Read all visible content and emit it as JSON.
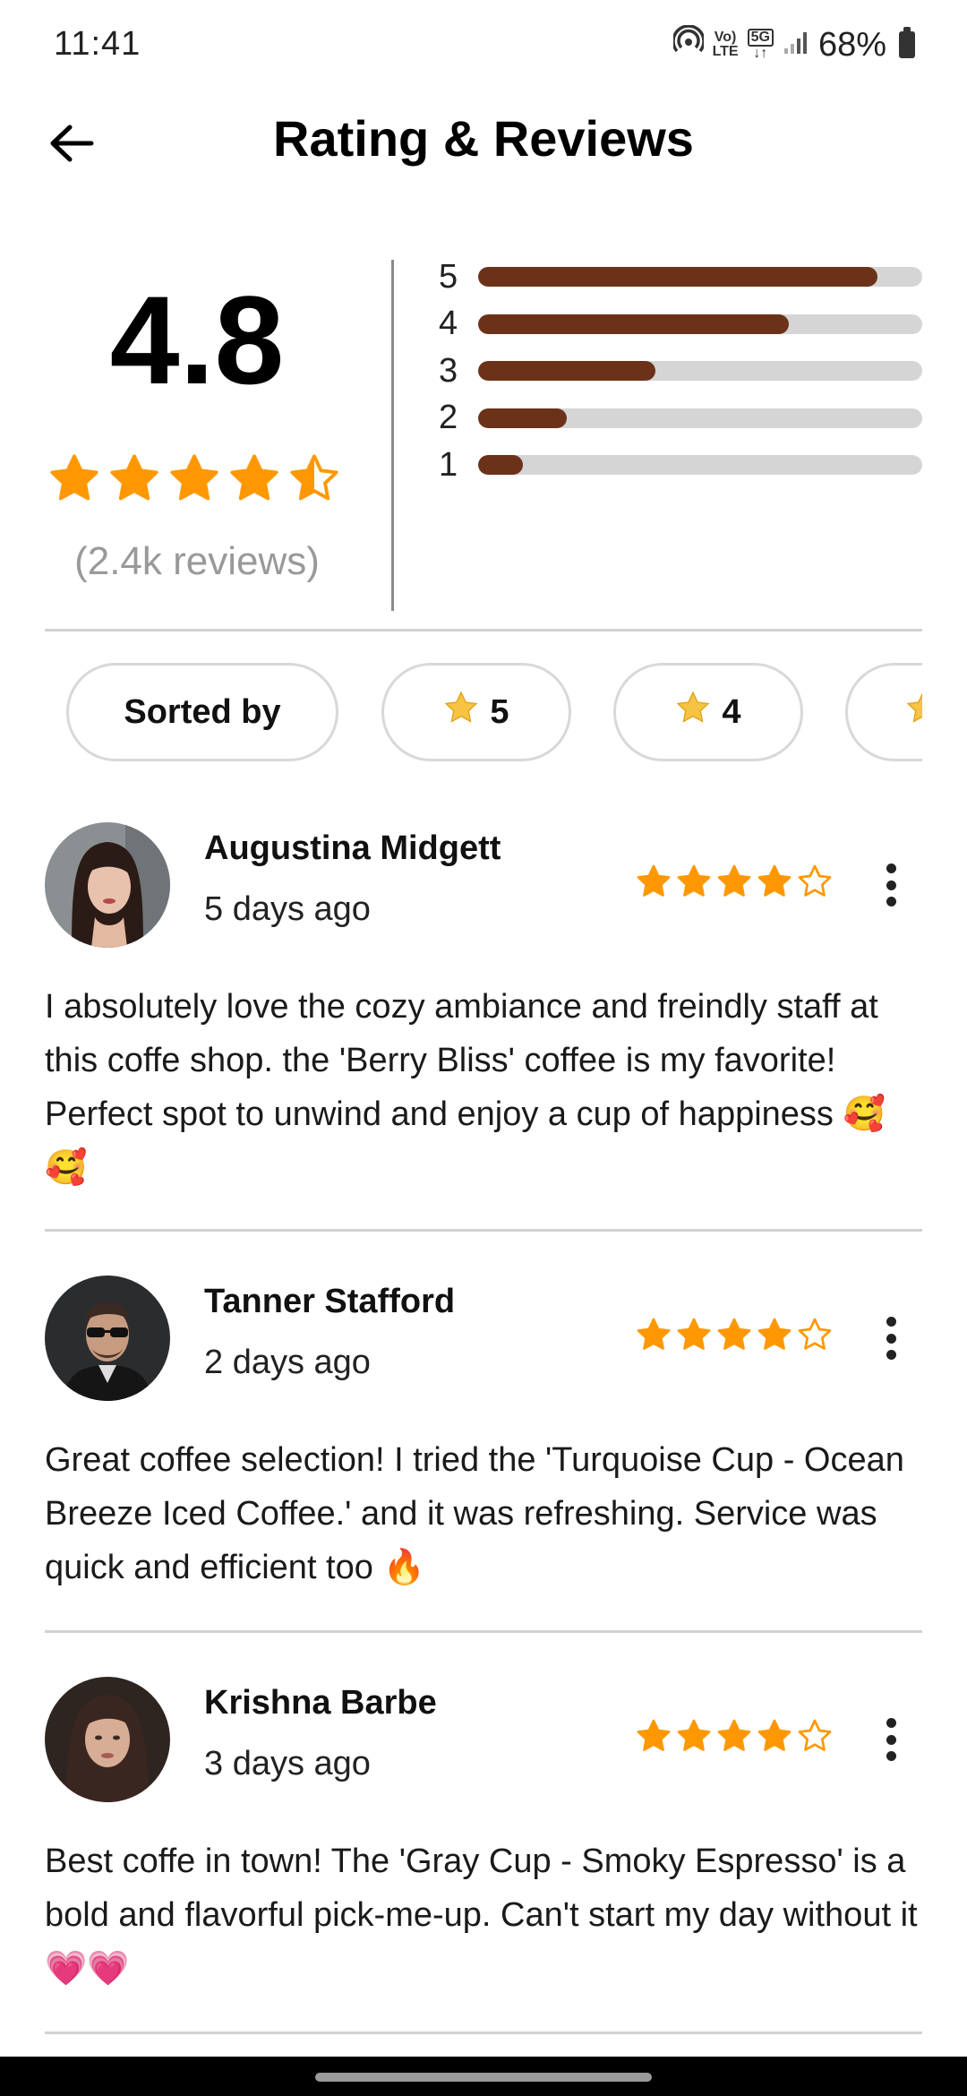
{
  "status_bar": {
    "time": "11:41",
    "volte_line1": "Vo)",
    "volte_line2": "LTE",
    "network": "5G",
    "battery": "68%"
  },
  "header": {
    "title": "Rating & Reviews",
    "back_icon": "arrow-left-icon"
  },
  "summary": {
    "average": "4.8",
    "average_stars": 4.5,
    "review_count": "(2.4k reviews)",
    "distribution": [
      {
        "label": "5",
        "fraction": 0.9
      },
      {
        "label": "4",
        "fraction": 0.7
      },
      {
        "label": "3",
        "fraction": 0.4
      },
      {
        "label": "2",
        "fraction": 0.2
      },
      {
        "label": "1",
        "fraction": 0.1
      }
    ],
    "bar_color": "#6b3219",
    "track_color": "#d5d5d5"
  },
  "filters": {
    "sorted_by": "Sorted by",
    "chips": [
      "5",
      "4"
    ]
  },
  "colors": {
    "star": "#ff9800",
    "chip_star": "#f6c343"
  },
  "reviews": [
    {
      "name": "Augustina Midgett",
      "date": "5 days ago",
      "rating": 4,
      "text": "I absolutely love the cozy ambiance and freindly staff at this coffe shop. the 'Berry Bliss' coffee is my favorite! Perfect spot to unwind and enjoy a cup of happiness 🥰🥰"
    },
    {
      "name": "Tanner Stafford",
      "date": "2 days ago",
      "rating": 4,
      "text": "Great coffee selection! I tried the 'Turquoise Cup - Ocean Breeze Iced Coffee.' and it was refreshing. Service was quick and efficient too 🔥"
    },
    {
      "name": "Krishna Barbe",
      "date": "3 days ago",
      "rating": 4,
      "text": "Best coffe in town! The 'Gray Cup - Smoky Espresso' is a bold and flavorful pick-me-up. Can't start my day without it 💗💗"
    }
  ]
}
